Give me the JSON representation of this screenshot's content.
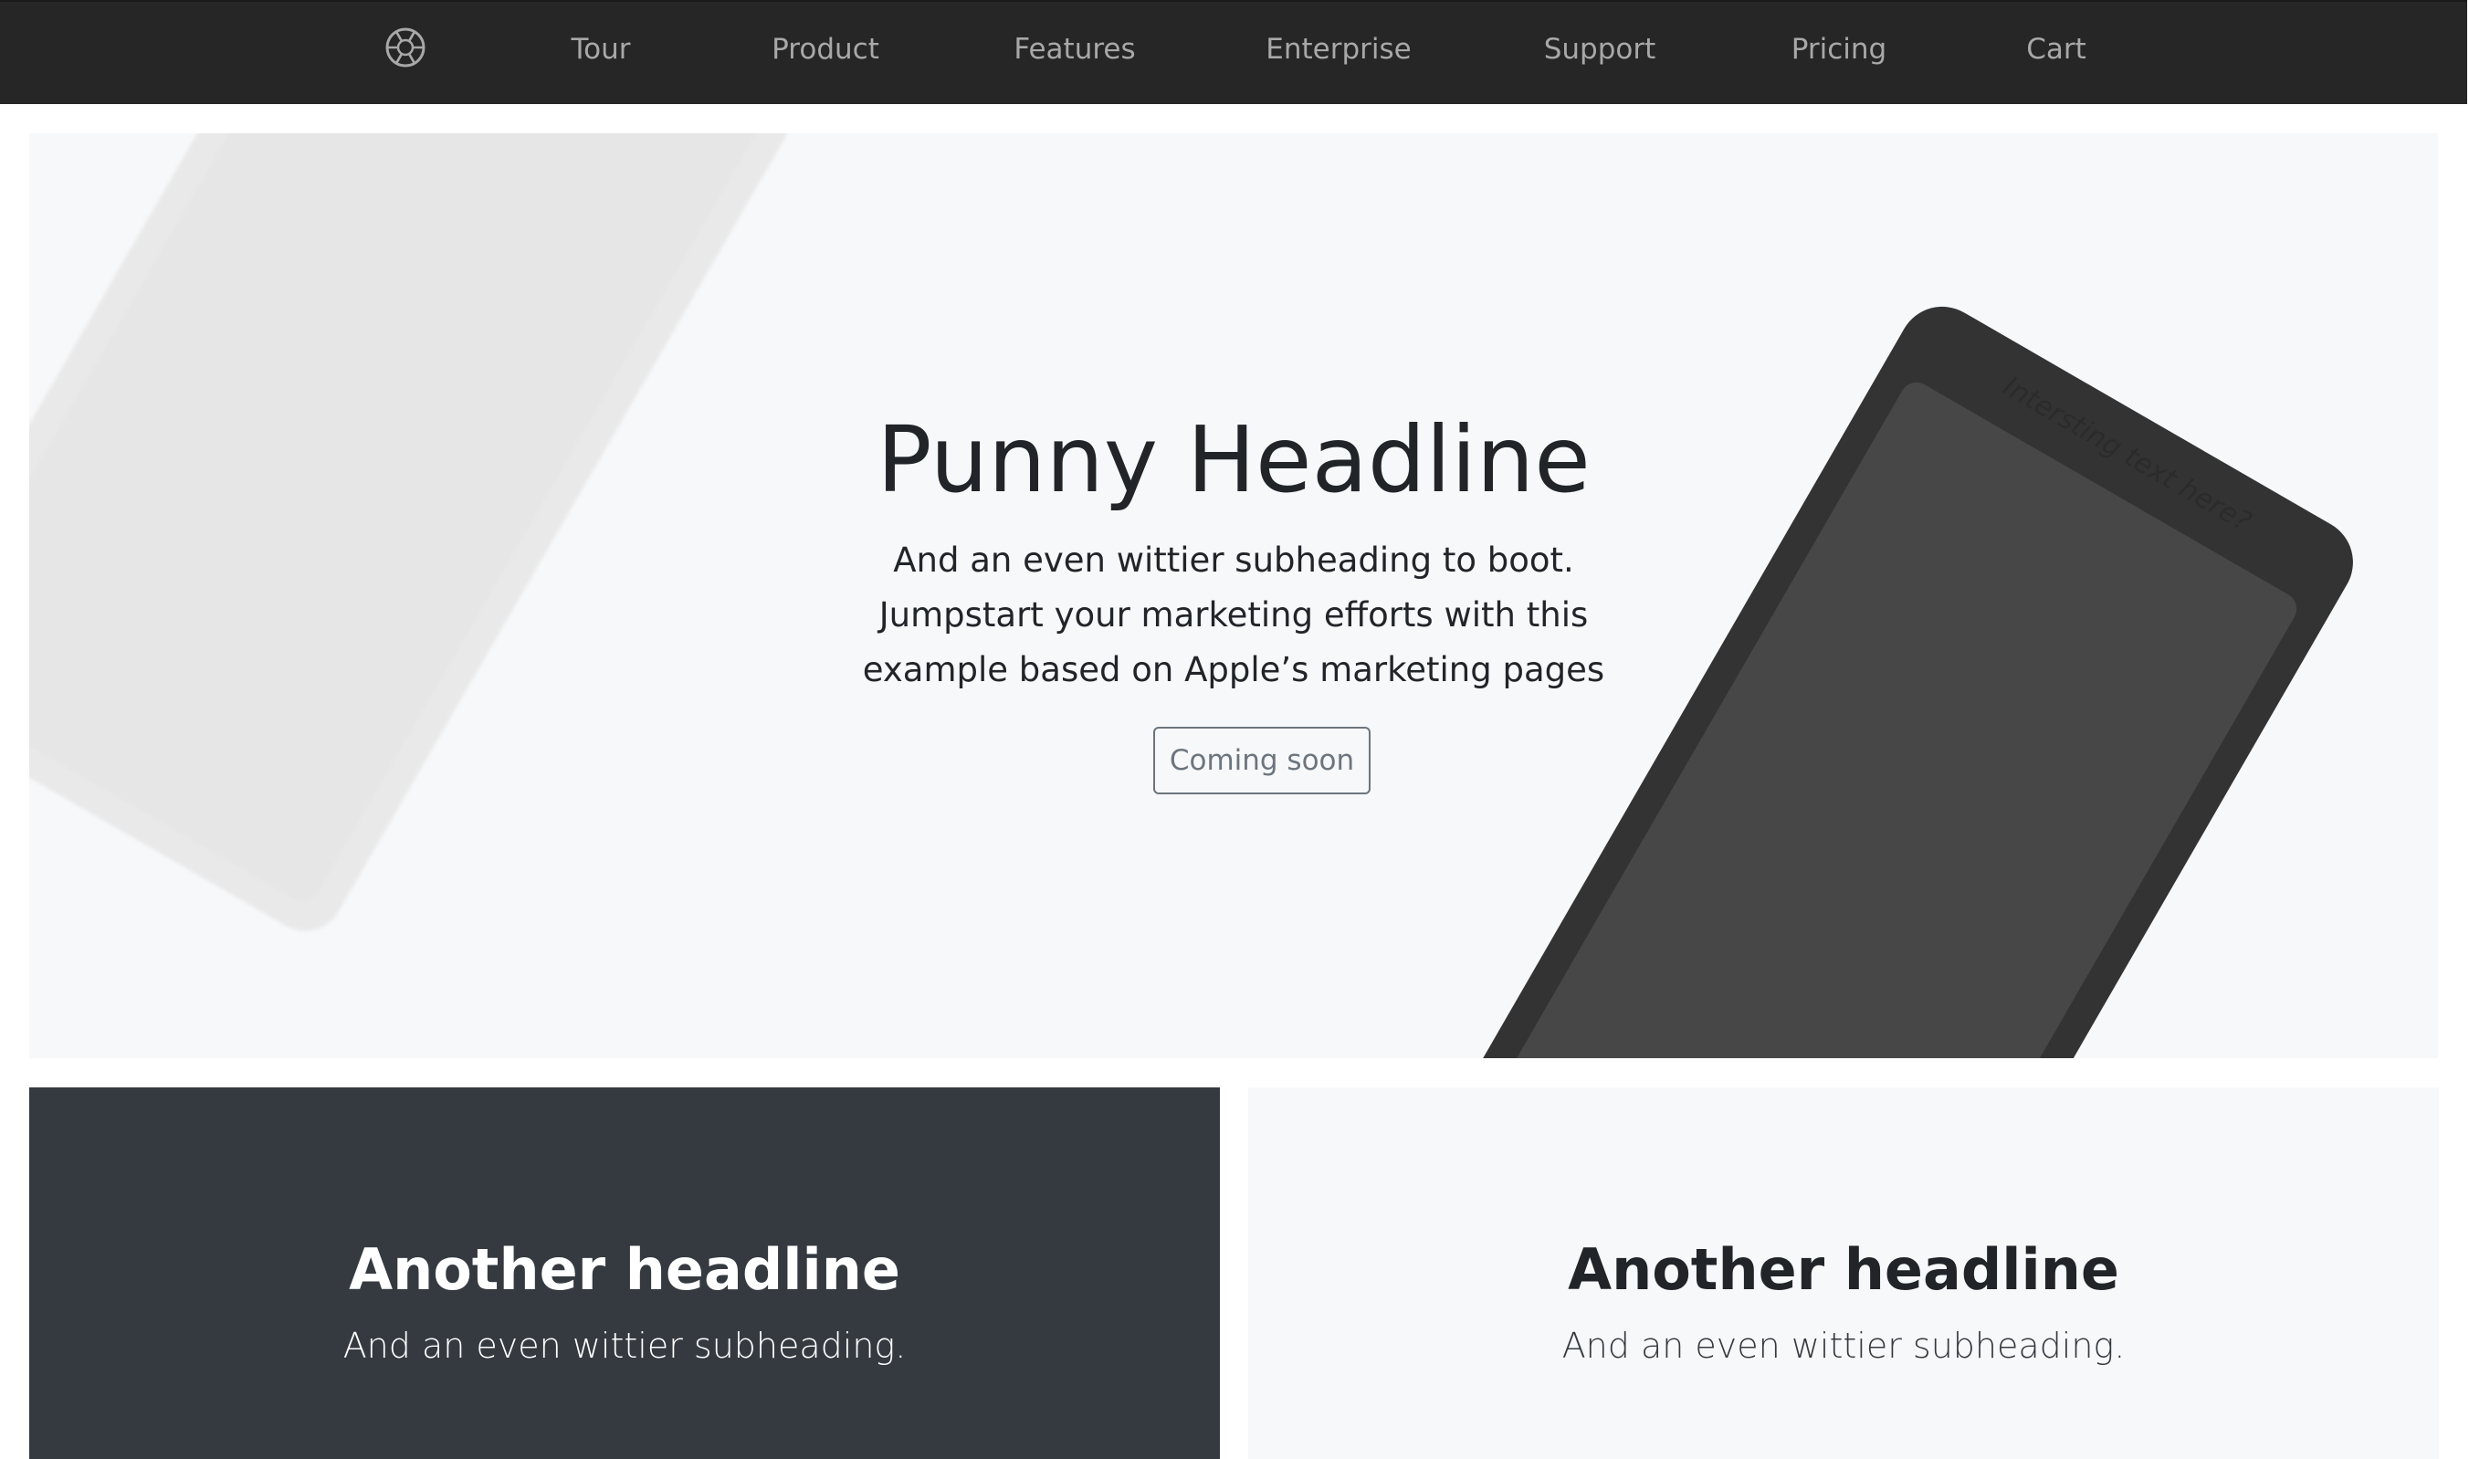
{
  "nav": {
    "logo_icon": "aperture-icon",
    "items": [
      {
        "label": "Tour"
      },
      {
        "label": "Product"
      },
      {
        "label": "Features"
      },
      {
        "label": "Enterprise"
      },
      {
        "label": "Support"
      },
      {
        "label": "Pricing"
      },
      {
        "label": "Cart"
      }
    ]
  },
  "hero": {
    "title": "Punny Headline",
    "subheading": "And an even wittier subheading to boot. Jumpstart your marketing efforts with this example based on Apple’s marketing pages",
    "button_label": "Coming soon",
    "device_text": "Intersting text here?"
  },
  "panels": [
    {
      "title": "Another headline",
      "subheading": "And an even wittier subheading."
    },
    {
      "title": "Another headline",
      "subheading": "And an even wittier subheading."
    }
  ],
  "colors": {
    "navbar_bg": "#262626",
    "nav_text": "#a8a8a8",
    "hero_bg": "#f7f8fa",
    "dark_panel_bg": "#343a40",
    "device_dark": "#333333",
    "device_light": "#e9e9e9"
  }
}
